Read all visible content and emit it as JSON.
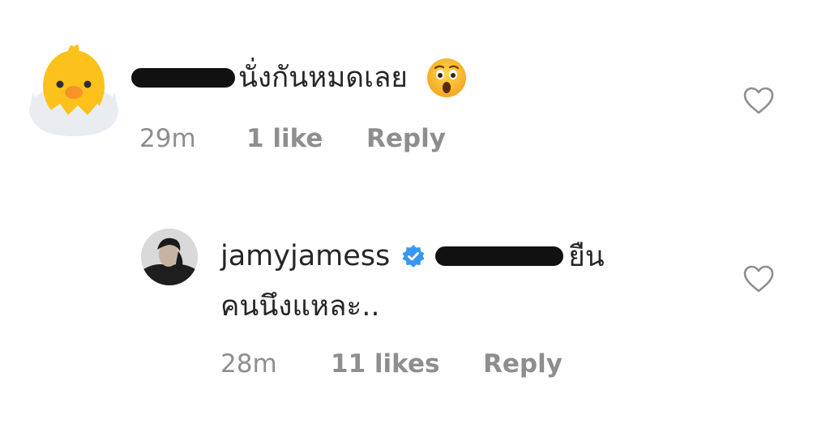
{
  "comments": [
    {
      "username": "redacted",
      "text": "นั่งกันหมดเลย",
      "emoji": "astonished-face",
      "time": "29m",
      "likes": "1 like",
      "reply_label": "Reply"
    },
    {
      "username": "jamyjamess",
      "verified": true,
      "mention": "redacted",
      "text_line1": "ยืน",
      "text_line2": "คนนึงแหละ..",
      "time": "28m",
      "likes": "11 likes",
      "reply_label": "Reply"
    }
  ],
  "colors": {
    "text": "#262626",
    "meta": "#8e8e8e",
    "verified_blue": "#3897f0",
    "chick_yellow": "#fcc21b",
    "redaction": "#111111"
  },
  "icons": [
    "chick-avatar-icon",
    "astonished-emoji-icon",
    "heart-outline-icon",
    "verified-badge-icon"
  ]
}
